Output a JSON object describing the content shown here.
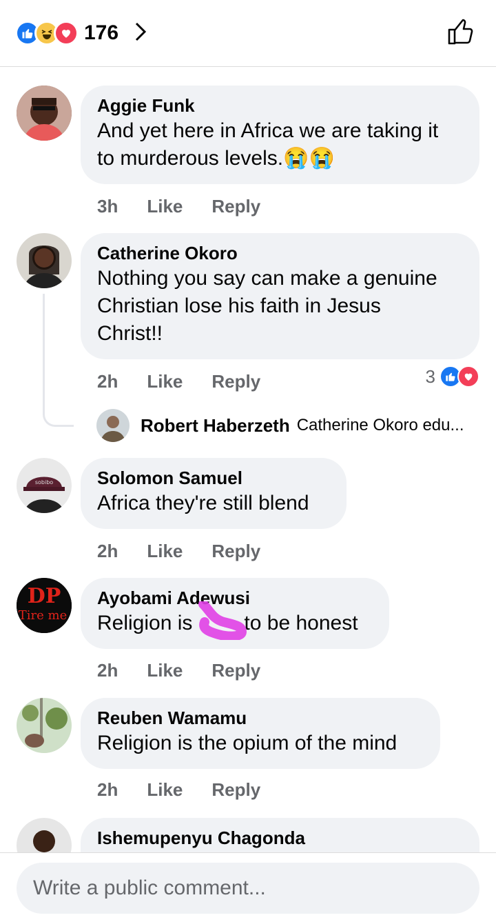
{
  "header": {
    "reaction_count": "176",
    "reaction_icons": [
      "like-icon",
      "haha-icon",
      "love-icon"
    ]
  },
  "comments": [
    {
      "name": "Aggie Funk",
      "text_lines": [
        "And yet here in Africa we are taking it",
        "to murderous levels."
      ],
      "emoji": "😭😭",
      "time": "3h",
      "like": "Like",
      "reply": "Reply"
    },
    {
      "name": "Catherine Okoro",
      "text_lines": [
        "Nothing you say can make a genuine",
        "Christian lose his faith in Jesus",
        "Christ!!"
      ],
      "time": "2h",
      "like": "Like",
      "reply": "Reply",
      "reactions_count": "3",
      "reply_preview": {
        "name": "Robert Haberzeth",
        "text": "Catherine Okoro  edu..."
      }
    },
    {
      "name": "Solomon Samuel",
      "text_lines": [
        "Africa they're still blend"
      ],
      "time": "2h",
      "like": "Like",
      "reply": "Reply"
    },
    {
      "name": "Ayobami Adewusi",
      "text_lines": [
        "Religion is         to be honest"
      ],
      "time": "2h",
      "like": "Like",
      "reply": "Reply"
    },
    {
      "name": "Reuben Wamamu",
      "text_lines": [
        "Religion is the opium of the mind"
      ],
      "time": "2h",
      "like": "Like",
      "reply": "Reply"
    },
    {
      "name": "Ishemupenyu Chagonda"
    }
  ],
  "avatar_text": {
    "dp_logo": "DP",
    "dp_sub": "Tire me",
    "hat_logo": "sobibo"
  },
  "footer": {
    "placeholder": "Write a public comment..."
  },
  "colors": {
    "facebook_blue": "#1877f2",
    "love_red": "#f33e58",
    "haha_yellow": "#f7c64a",
    "bubble_bg": "#f0f2f5",
    "meta_gray": "#65676b"
  }
}
